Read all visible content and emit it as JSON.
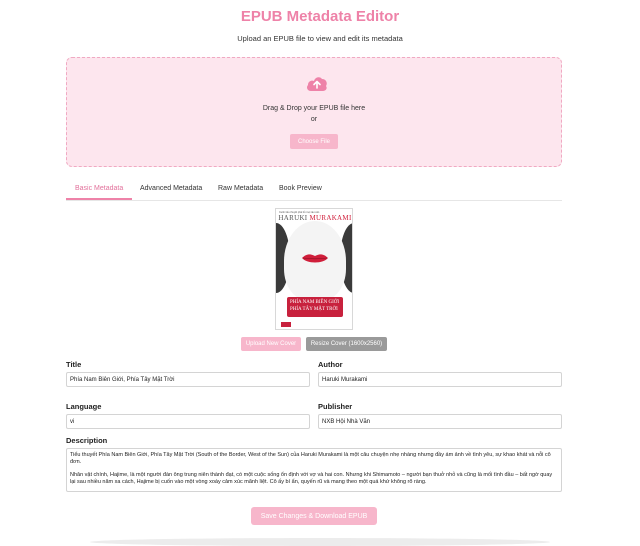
{
  "header": {
    "title": "EPUB Metadata Editor",
    "subtitle": "Upload an EPUB file to view and edit its metadata"
  },
  "dropzone": {
    "icon": "cloud-upload-icon",
    "prompt": "Drag & Drop your EPUB file here",
    "or": "or",
    "choose_label": "Choose File"
  },
  "tabs": [
    {
      "label": "Basic Metadata",
      "active": true
    },
    {
      "label": "Advanced Metadata",
      "active": false
    },
    {
      "label": "Raw Metadata",
      "active": false
    },
    {
      "label": "Book Preview",
      "active": false
    }
  ],
  "cover": {
    "tagline": "Cuốn tiểu thuyết phá bỏ mọi rào cản",
    "author_first": "HARUKI",
    "author_last": "MURAKAMI",
    "title_line1": "PHÍA NAM BIÊN GIỚI",
    "title_line2": "PHÍA TÂY MẶT TRỜI"
  },
  "cover_actions": {
    "upload_label": "Upload New Cover",
    "resize_label": "Resize Cover (1600x2560)"
  },
  "fields": {
    "title_label": "Title",
    "title_value": "Phía Nam Biên Giới, Phía Tây Mặt Trời",
    "author_label": "Author",
    "author_value": "Haruki Murakami",
    "language_label": "Language",
    "language_value": "vi",
    "publisher_label": "Publisher",
    "publisher_value": "NXB Hội Nhà Văn",
    "description_label": "Description",
    "description_p1": "Tiểu thuyết Phía Nam Biên Giới, Phía Tây Mặt Trời (South of the Border, West of the Sun) của Haruki Murakami là một câu chuyện nhẹ nhàng nhưng đầy ám ảnh về tình yêu, sự khao khát và nỗi cô đơn.",
    "description_p2": "Nhân vật chính, Hajime, là một người đàn ông trung niên thành đạt, có một cuộc sống ổn định với vợ và hai con. Nhưng khi Shimamoto – người bạn thuở nhỏ và cũng là mối tình đầu – bất ngờ quay lại sau nhiều năm xa cách, Hajime bị cuốn vào một vòng xoáy cảm xúc mãnh liệt. Cô ấy bí ẩn, quyến rũ và mang theo một quá khứ không rõ ràng."
  },
  "actions": {
    "save_label": "Save Changes & Download EPUB"
  },
  "colors": {
    "accent": "#ee82a8",
    "button_pink": "#f7b6cb",
    "dropzone_bg": "#fde6ee",
    "button_gray": "#9a9a9a"
  }
}
